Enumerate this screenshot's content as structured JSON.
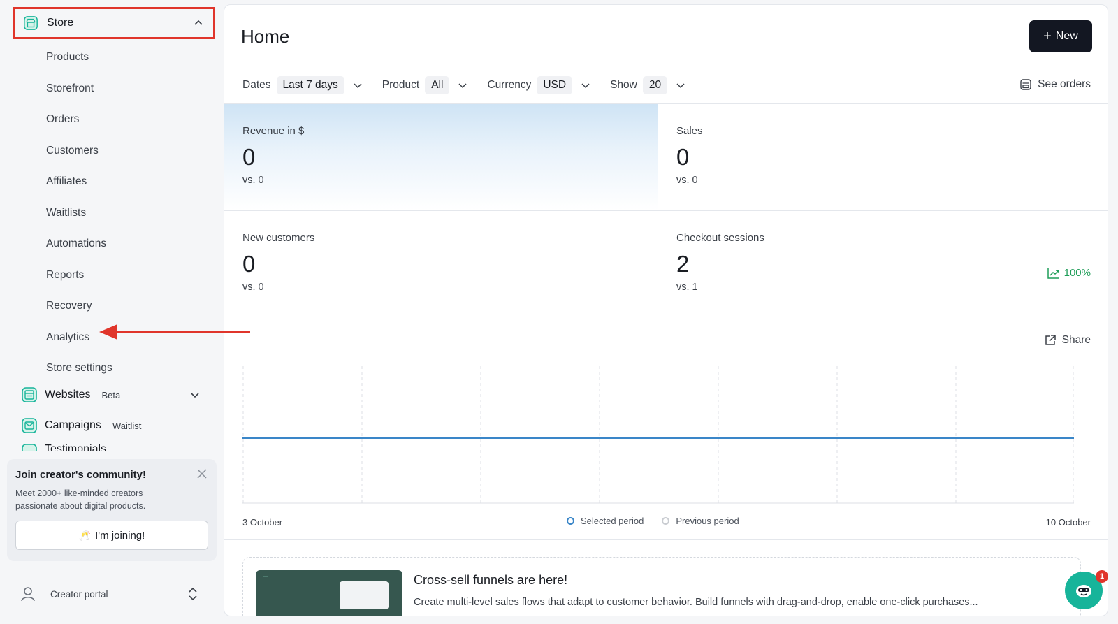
{
  "sidebar": {
    "store_label": "Store",
    "store_items": [
      "Products",
      "Storefront",
      "Orders",
      "Customers",
      "Affiliates",
      "Waitlists",
      "Automations",
      "Reports",
      "Recovery",
      "Analytics",
      "Store settings"
    ],
    "websites": {
      "label": "Websites",
      "tag": "Beta"
    },
    "campaigns": {
      "label": "Campaigns",
      "tag": "Waitlist"
    },
    "testimonials": {
      "label": "Testimonials"
    },
    "community": {
      "title": "Join creator's community!",
      "description": "Meet 2000+ like-minded creators passionate about digital products.",
      "button": "I'm joining!"
    },
    "portal": {
      "label": "Creator portal"
    }
  },
  "header": {
    "title": "Home",
    "new_button": "New",
    "see_orders": "See orders"
  },
  "filters": [
    {
      "label": "Dates",
      "value": "Last 7 days"
    },
    {
      "label": "Product",
      "value": "All"
    },
    {
      "label": "Currency",
      "value": "USD"
    },
    {
      "label": "Show",
      "value": "20"
    }
  ],
  "metrics": {
    "revenue": {
      "label": "Revenue in $",
      "value": "0",
      "previous": "vs. 0"
    },
    "sales": {
      "label": "Sales",
      "value": "0",
      "previous": "vs. 0"
    },
    "new_customers": {
      "label": "New customers",
      "value": "0",
      "previous": "vs. 0"
    },
    "checkout_sessions": {
      "label": "Checkout sessions",
      "value": "2",
      "previous": "vs. 1",
      "change": "100%"
    }
  },
  "chart": {
    "share": "Share",
    "x_start": "3 October",
    "x_end": "10 October",
    "legend": [
      "Selected period",
      "Previous period"
    ],
    "colors": {
      "selected": "#3a86c8",
      "previous": "#c9ccd1"
    }
  },
  "promo": {
    "title": "Cross-sell funnels are here!",
    "description": "Create multi-level sales flows that adapt to customer behavior. Build funnels with drag-and-drop, enable one-click purchases..."
  },
  "chat": {
    "badge": "1"
  },
  "colors": {
    "accent": "#17b49a",
    "primary_button": "#131722",
    "highlight": "#e0352b",
    "trend_up": "#1f9d58"
  }
}
